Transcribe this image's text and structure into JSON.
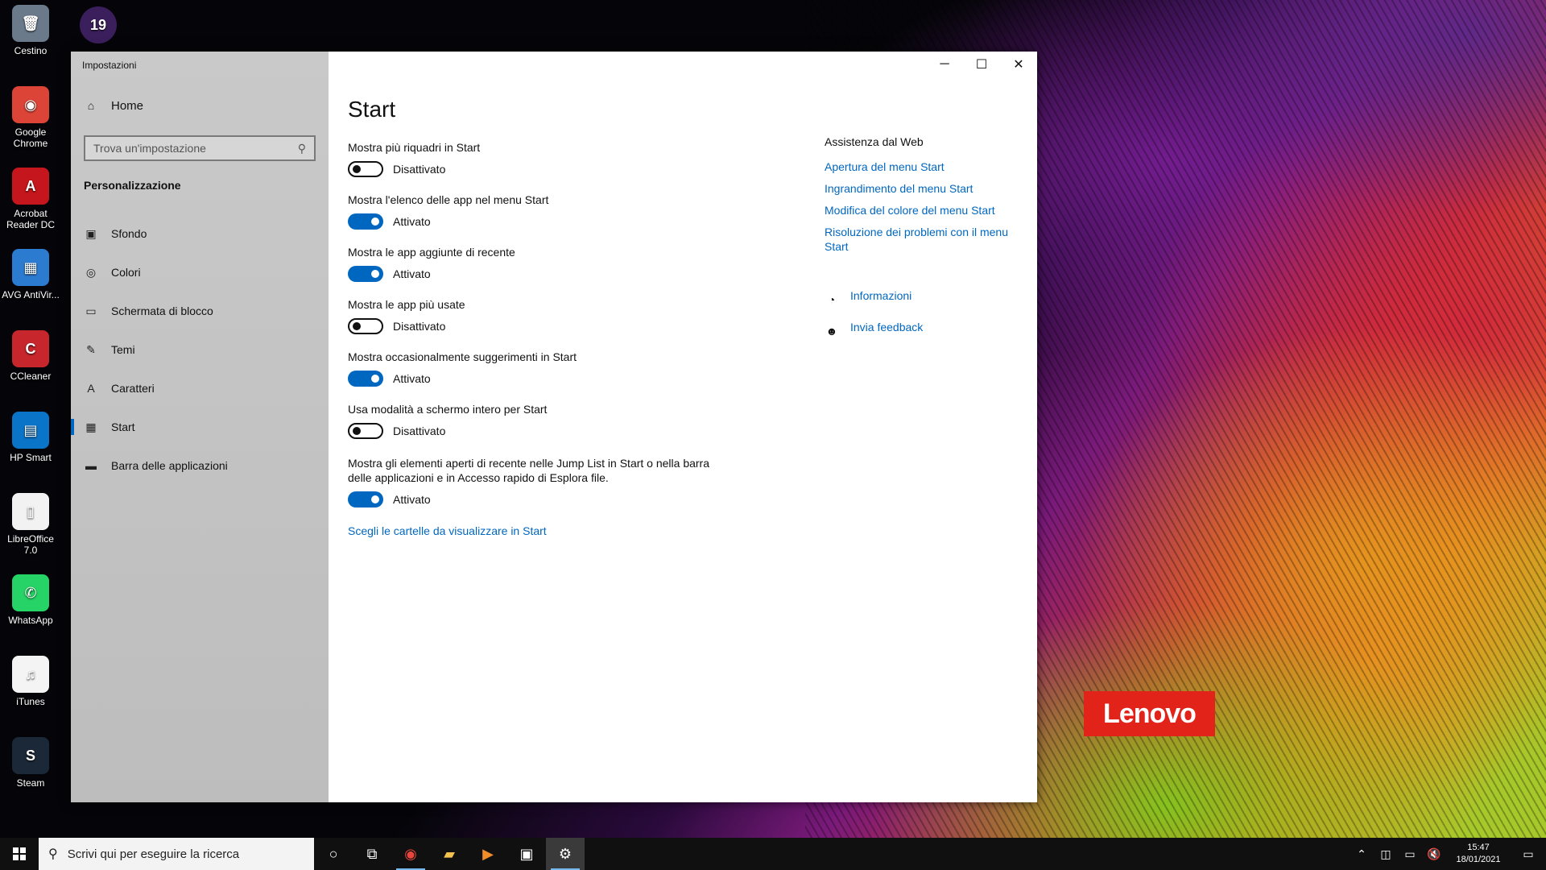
{
  "desktop": {
    "icons": [
      {
        "label": "Cestino",
        "color": "#6a7a8a",
        "glyph": "🗑"
      },
      {
        "label": "Google Chrome",
        "color": "#db4437",
        "glyph": "◉"
      },
      {
        "label": "Acrobat Reader DC",
        "color": "#c4161c",
        "glyph": "A"
      },
      {
        "label": "AVG AntiVir...",
        "color": "#2b7bd1",
        "glyph": "▦"
      },
      {
        "label": "CCleaner",
        "color": "#c8262d",
        "glyph": "C"
      },
      {
        "label": "HP Smart",
        "color": "#0a74c9",
        "glyph": "▤"
      },
      {
        "label": "LibreOffice 7.0",
        "color": "#f2f2f2",
        "glyph": "▯"
      },
      {
        "label": "WhatsApp",
        "color": "#25d366",
        "glyph": "✆"
      },
      {
        "label": "iTunes",
        "color": "#f4f4f4",
        "glyph": "♫"
      },
      {
        "label": "Steam",
        "color": "#1b2838",
        "glyph": "S"
      }
    ],
    "football_icon": "19",
    "brand": "Lenovo"
  },
  "window": {
    "title": "Impostazioni",
    "controls": {
      "minimize": "─",
      "maximize": "☐",
      "close": "✕"
    }
  },
  "sidebar": {
    "home": "Home",
    "search_placeholder": "Trova un'impostazione",
    "section": "Personalizzazione",
    "items": [
      {
        "label": "Sfondo",
        "icon": "picture-icon",
        "glyph": "▣"
      },
      {
        "label": "Colori",
        "icon": "palette-icon",
        "glyph": "◎"
      },
      {
        "label": "Schermata di blocco",
        "icon": "lock-screen-icon",
        "glyph": "▭"
      },
      {
        "label": "Temi",
        "icon": "themes-icon",
        "glyph": "✎"
      },
      {
        "label": "Caratteri",
        "icon": "fonts-icon",
        "glyph": "A"
      },
      {
        "label": "Start",
        "icon": "start-icon",
        "glyph": "▦"
      },
      {
        "label": "Barra delle applicazioni",
        "icon": "taskbar-icon",
        "glyph": "▬"
      }
    ]
  },
  "main": {
    "title": "Start",
    "settings": [
      {
        "label": "Mostra più riquadri in Start",
        "on": false,
        "state": "Disattivato"
      },
      {
        "label": "Mostra l'elenco delle app nel menu Start",
        "on": true,
        "state": "Attivato"
      },
      {
        "label": "Mostra le app aggiunte di recente",
        "on": true,
        "state": "Attivato"
      },
      {
        "label": "Mostra le app più usate",
        "on": false,
        "state": "Disattivato"
      },
      {
        "label": "Mostra occasionalmente suggerimenti in Start",
        "on": true,
        "state": "Attivato"
      },
      {
        "label": "Usa modalità a schermo intero per Start",
        "on": false,
        "state": "Disattivato"
      },
      {
        "label": "Mostra gli elementi aperti di recente nelle Jump List in Start o nella barra delle applicazioni e in Accesso rapido di Esplora file.",
        "on": true,
        "state": "Attivato"
      }
    ],
    "folders_link": "Scegli le cartelle da visualizzare in Start"
  },
  "aside": {
    "header": "Assistenza dal Web",
    "links": [
      "Apertura del menu Start",
      "Ingrandimento del menu Start",
      "Modifica del colore del menu Start",
      "Risoluzione dei problemi con il menu Start"
    ],
    "info": "Informazioni",
    "feedback": "Invia feedback"
  },
  "taskbar": {
    "search_placeholder": "Scrivi qui per eseguire la ricerca",
    "time": "15:47",
    "date": "18/01/2021"
  }
}
